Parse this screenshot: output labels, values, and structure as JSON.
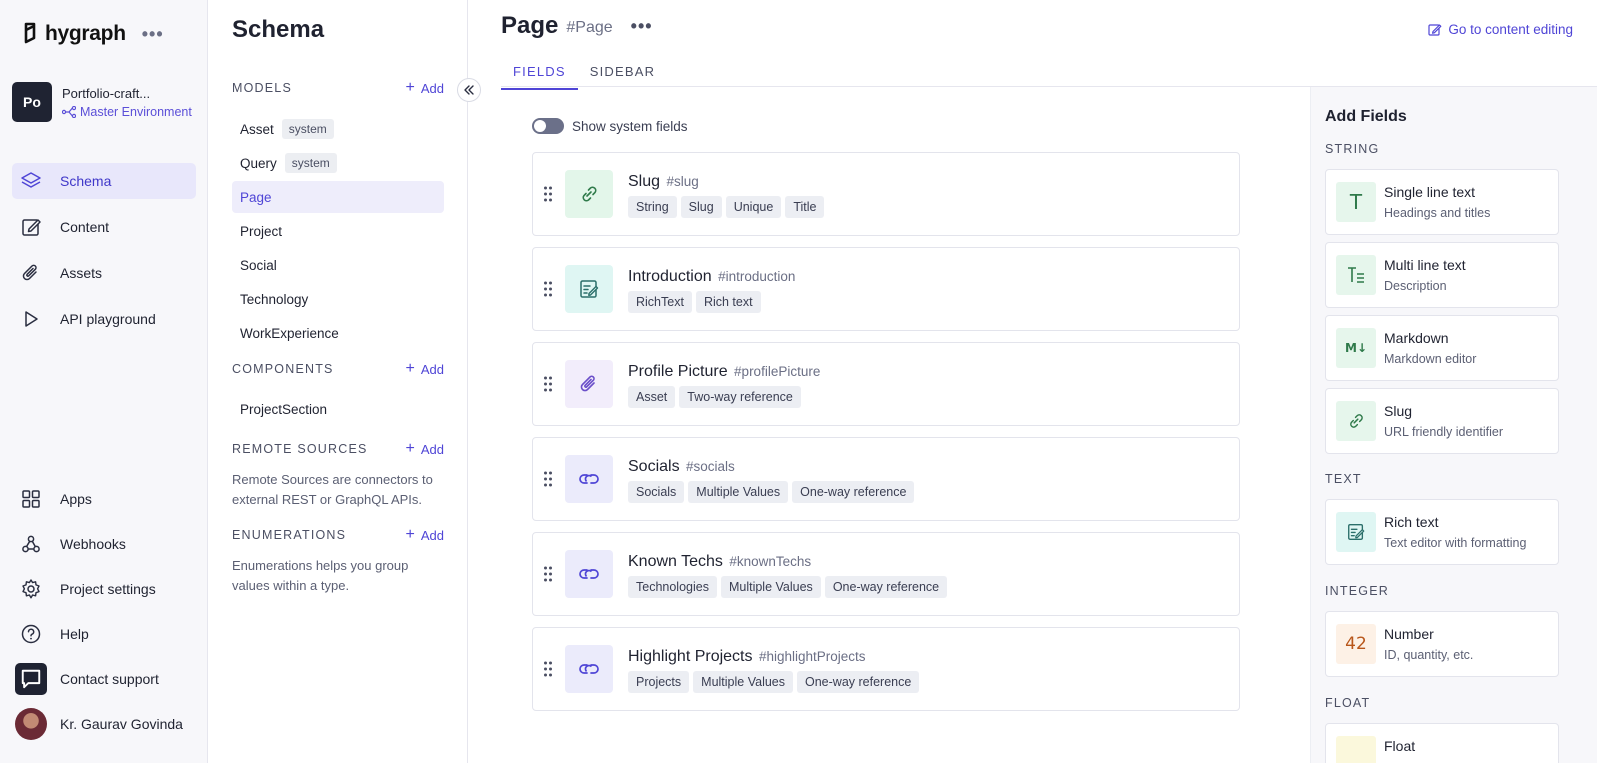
{
  "app": {
    "brand": "hygraph",
    "project_initials": "Po",
    "project_name": "Portfolio-craft...",
    "environment": "Master Environment"
  },
  "nav": {
    "items": [
      {
        "label": "Schema",
        "icon": "layers-icon",
        "active": true
      },
      {
        "label": "Content",
        "icon": "edit-icon"
      },
      {
        "label": "Assets",
        "icon": "paperclip-icon"
      },
      {
        "label": "API playground",
        "icon": "play-icon"
      }
    ],
    "bottom": [
      {
        "label": "Apps",
        "icon": "grid-icon"
      },
      {
        "label": "Webhooks",
        "icon": "webhook-icon"
      },
      {
        "label": "Project settings",
        "icon": "gear-icon"
      },
      {
        "label": "Help",
        "icon": "help-icon"
      },
      {
        "label": "Contact support",
        "icon": "chat-icon"
      },
      {
        "label": "Kr. Gaurav Govinda",
        "icon": "avatar"
      }
    ]
  },
  "schema": {
    "title": "Schema",
    "add_label": "Add",
    "models_label": "MODELS",
    "models": [
      {
        "name": "Asset",
        "badge": "system"
      },
      {
        "name": "Query",
        "badge": "system"
      },
      {
        "name": "Page",
        "active": true
      },
      {
        "name": "Project"
      },
      {
        "name": "Social"
      },
      {
        "name": "Technology"
      },
      {
        "name": "WorkExperience"
      }
    ],
    "components_label": "COMPONENTS",
    "components": [
      "ProjectSection"
    ],
    "remote_label": "REMOTE SOURCES",
    "remote_text": "Remote Sources are connectors to external REST or GraphQL APIs.",
    "enum_label": "ENUMERATIONS",
    "enum_text": "Enumerations helps you group values within a type."
  },
  "page": {
    "title": "Page",
    "api_id": "#Page",
    "goto_label": "Go to content editing",
    "tabs": [
      "FIELDS",
      "SIDEBAR"
    ],
    "toggle_label": "Show system fields",
    "fields": [
      {
        "name": "Slug",
        "id": "#slug",
        "icon": "link-icon",
        "tags": [
          "String",
          "Slug",
          "Unique",
          "Title"
        ],
        "bg": "#e3f6ea",
        "fg": "#2f7a4a"
      },
      {
        "name": "Introduction",
        "id": "#introduction",
        "icon": "richtext-icon",
        "tags": [
          "RichText",
          "Rich text"
        ],
        "bg": "#dff6f3",
        "fg": "#2b6f6a"
      },
      {
        "name": "Profile Picture",
        "id": "#profilePicture",
        "icon": "paperclip-icon",
        "tags": [
          "Asset",
          "Two-way reference"
        ],
        "bg": "#f2edfb",
        "fg": "#6b4fc9"
      },
      {
        "name": "Socials",
        "id": "#socials",
        "icon": "reference-icon",
        "tags": [
          "Socials",
          "Multiple Values",
          "One-way reference"
        ],
        "bg": "#ebebfb",
        "fg": "#4f45d6"
      },
      {
        "name": "Known Techs",
        "id": "#knownTechs",
        "icon": "reference-icon",
        "tags": [
          "Technologies",
          "Multiple Values",
          "One-way reference"
        ],
        "bg": "#ebebfb",
        "fg": "#4f45d6"
      },
      {
        "name": "Highlight Projects",
        "id": "#highlightProjects",
        "icon": "reference-icon",
        "tags": [
          "Projects",
          "Multiple Values",
          "One-way reference"
        ],
        "bg": "#ebebfb",
        "fg": "#4f45d6"
      }
    ]
  },
  "add_fields": {
    "title": "Add Fields",
    "groups": [
      {
        "label": "STRING",
        "items": [
          {
            "name": "Single line text",
            "desc": "Headings and titles",
            "glyph": "T",
            "icon": "single-line-text-icon",
            "bg": "#e6f6ec",
            "fg": "#2f7a4a"
          },
          {
            "name": "Multi line text",
            "desc": "Description",
            "glyph": "T≡",
            "icon": "multi-line-text-icon",
            "bg": "#e6f6ec",
            "fg": "#2f7a4a"
          },
          {
            "name": "Markdown",
            "desc": "Markdown editor",
            "glyph": "M↓",
            "icon": "markdown-icon",
            "bg": "#e6f6ec",
            "fg": "#2f7a4a"
          },
          {
            "name": "Slug",
            "desc": "URL friendly identifier",
            "glyph": "link",
            "icon": "link-icon",
            "bg": "#e6f6ec",
            "fg": "#2f7a4a"
          }
        ]
      },
      {
        "label": "TEXT",
        "items": [
          {
            "name": "Rich text",
            "desc": "Text editor with formatting",
            "glyph": "rich",
            "icon": "richtext-icon",
            "bg": "#dff6f3",
            "fg": "#2b6f6a"
          }
        ]
      },
      {
        "label": "INTEGER",
        "items": [
          {
            "name": "Number",
            "desc": "ID, quantity, etc.",
            "glyph": "42",
            "icon": "number-icon",
            "bg": "#fdf1e6",
            "fg": "#b8561a"
          }
        ]
      },
      {
        "label": "FLOAT",
        "items": [
          {
            "name": "Float",
            "desc": "",
            "glyph": "",
            "icon": "float-icon",
            "bg": "#fbf8dc",
            "fg": "#8a7a1a"
          }
        ]
      }
    ]
  }
}
